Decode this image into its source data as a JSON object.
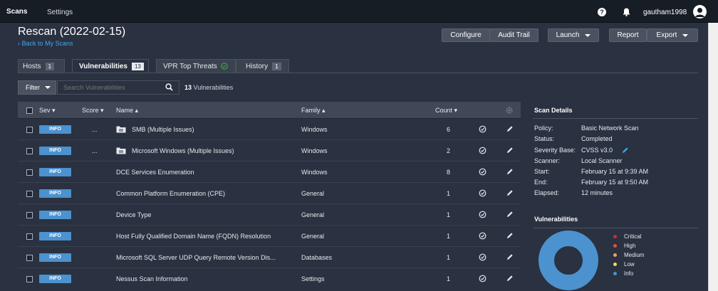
{
  "topbar": {
    "scans": "Scans",
    "settings": "Settings",
    "help": "?",
    "username": "gautham1998"
  },
  "page": {
    "title": "Rescan (2022-02-15)",
    "back": "Back to My Scans"
  },
  "toolbar": {
    "configure": "Configure",
    "audit_trail": "Audit Trail",
    "launch": "Launch",
    "report": "Report",
    "export": "Export"
  },
  "tabs": [
    {
      "label": "Hosts",
      "count": "1"
    },
    {
      "label": "Vulnerabilities",
      "count": "13"
    },
    {
      "label": "VPR Top Threats"
    },
    {
      "label": "History",
      "count": "1"
    }
  ],
  "filter": {
    "label": "Filter",
    "placeholder": "Search Vulnerabilities",
    "count_number": "13",
    "count_label": "Vulnerabilities"
  },
  "table": {
    "headers": {
      "sev": "Sev",
      "score": "Score",
      "name": "Name",
      "family": "Family",
      "count": "Count"
    },
    "rows": [
      {
        "sev": "INFO",
        "score": "...",
        "name": "SMB (Multiple Issues)",
        "family": "Windows",
        "count": "6",
        "folder": true
      },
      {
        "sev": "INFO",
        "score": "...",
        "name": "Microsoft Windows (Multiple Issues)",
        "family": "Windows",
        "count": "2",
        "folder": true
      },
      {
        "sev": "INFO",
        "score": "",
        "name": "DCE Services Enumeration",
        "family": "Windows",
        "count": "8"
      },
      {
        "sev": "INFO",
        "score": "",
        "name": "Common Platform Enumeration (CPE)",
        "family": "General",
        "count": "1"
      },
      {
        "sev": "INFO",
        "score": "",
        "name": "Device Type",
        "family": "General",
        "count": "1"
      },
      {
        "sev": "INFO",
        "score": "",
        "name": "Host Fully Qualified Domain Name (FQDN) Resolution",
        "family": "General",
        "count": "1"
      },
      {
        "sev": "INFO",
        "score": "",
        "name": "Microsoft SQL Server UDP Query Remote Version Dis...",
        "family": "Databases",
        "count": "1"
      },
      {
        "sev": "INFO",
        "score": "",
        "name": "Nessus Scan Information",
        "family": "Settings",
        "count": "1"
      }
    ]
  },
  "scan_details": {
    "title": "Scan Details",
    "items": [
      {
        "key": "Policy:",
        "value": "Basic Network Scan"
      },
      {
        "key": "Status:",
        "value": "Completed"
      },
      {
        "key": "Severity Base:",
        "value": "CVSS v3.0"
      },
      {
        "key": "Scanner:",
        "value": "Local Scanner"
      },
      {
        "key": "Start:",
        "value": "February 15 at 9:39 AM"
      },
      {
        "key": "End:",
        "value": "February 15 at 9:50 AM"
      },
      {
        "key": "Elapsed:",
        "value": "12 minutes"
      }
    ]
  },
  "vulnerabilities_panel": {
    "title": "Vulnerabilities",
    "legend": [
      {
        "label": "Critical",
        "color": "#d43f3a"
      },
      {
        "label": "High",
        "color": "#ee9336"
      },
      {
        "label": "Medium",
        "color": "#fdc431"
      },
      {
        "label": "Low",
        "color": "#3fae49"
      },
      {
        "label": "Info",
        "color": "#357abd"
      }
    ],
    "legend_colors_shown": [
      "#c9302c",
      "#e25048",
      "#f0a05a",
      "#f5d75a",
      "#4b92cf"
    ],
    "donut": {
      "info_fraction": 1.0,
      "color": "#4b92cf"
    }
  },
  "colors": {
    "accent": "#3fa9f5",
    "info_badge": "#4b92cf",
    "background": "#2a3140"
  }
}
